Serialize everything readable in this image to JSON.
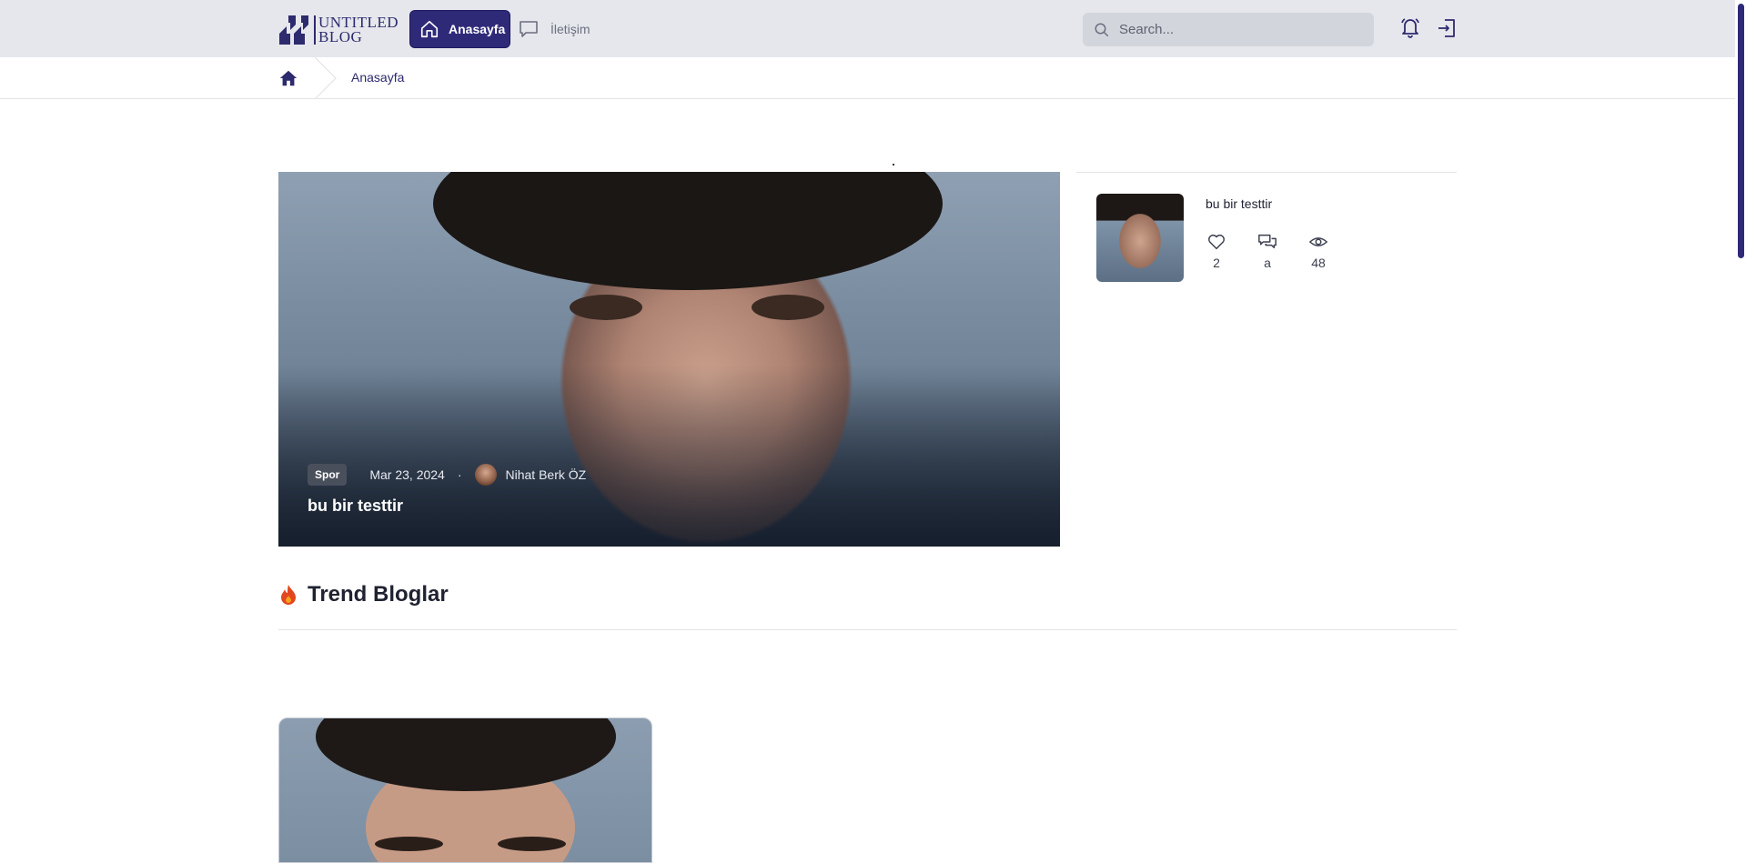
{
  "header": {
    "logo_line1": "Untitled",
    "logo_line2": "Blog",
    "nav": [
      {
        "label": "Anasayfa",
        "icon": "home-icon",
        "active": true
      },
      {
        "label": "İletişim",
        "icon": "chat-icon",
        "active": false
      }
    ],
    "search_placeholder": "Search..."
  },
  "breadcrumb": {
    "items": [
      {
        "label": "Anasayfa"
      }
    ]
  },
  "hero": {
    "category": "Spor",
    "date": "Mar 23, 2024",
    "separator": "·",
    "author": "Nihat Berk ÖZ",
    "title": "bu bir testtir"
  },
  "side_post": {
    "title": "bu bir testtir",
    "likes": "2",
    "comments": "a",
    "views": "48"
  },
  "trending": {
    "title": "Trend Bloglar"
  },
  "colors": {
    "brand": "#2f2a78",
    "header_bg": "#e6e7ec",
    "flame": "#e2461f"
  }
}
